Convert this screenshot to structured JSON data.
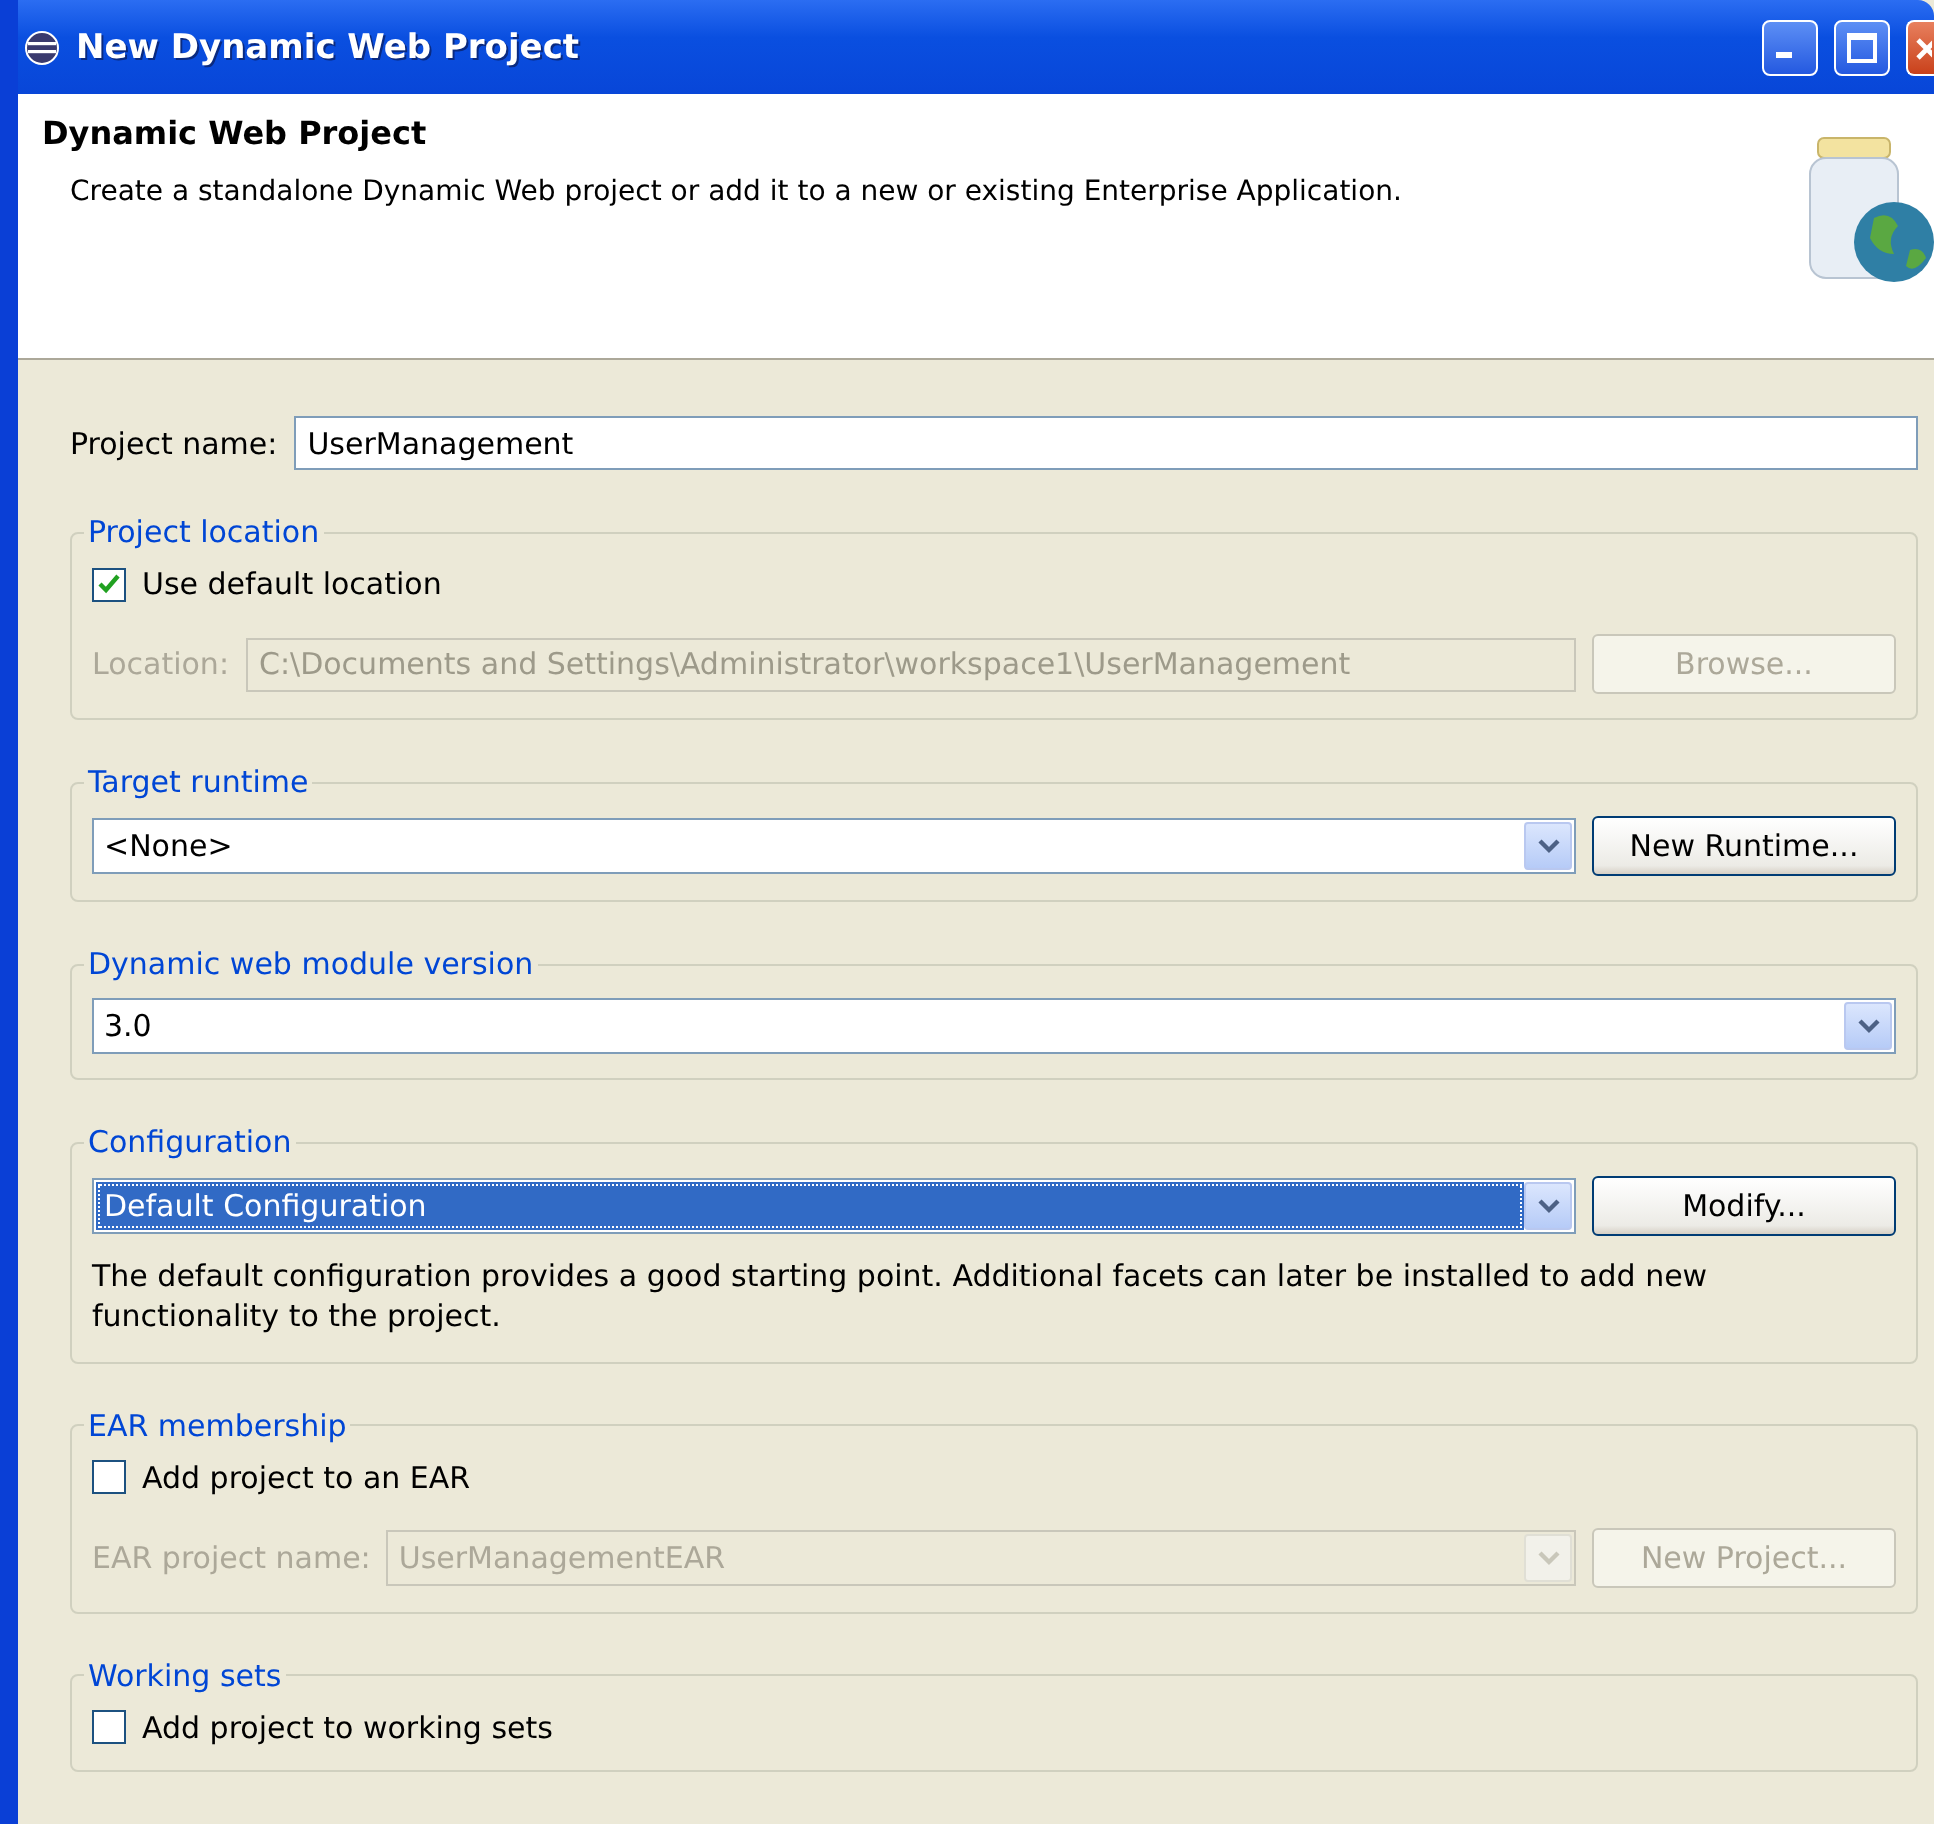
{
  "window": {
    "title": "New Dynamic Web Project"
  },
  "header": {
    "title": "Dynamic Web Project",
    "description": "Create a standalone Dynamic Web project or add it to a new or existing Enterprise Application."
  },
  "project_name": {
    "label": "Project name:",
    "value": "UserManagement"
  },
  "project_location": {
    "title": "Project location",
    "use_default": {
      "label": "Use default location",
      "checked": true
    },
    "location": {
      "label": "Location:",
      "value": "C:\\Documents and Settings\\Administrator\\workspace1\\UserManagement",
      "disabled": true
    },
    "button": {
      "label": "Browse...",
      "disabled": true
    }
  },
  "target_runtime": {
    "title": "Target runtime",
    "value": "<None>",
    "button": {
      "label": "New Runtime...",
      "disabled": false
    }
  },
  "module_version": {
    "title": "Dynamic web module version",
    "value": "3.0"
  },
  "configuration": {
    "title": "Configuration",
    "value": "Default Configuration",
    "selected": true,
    "button": {
      "label": "Modify...",
      "disabled": false
    },
    "description": "The default configuration provides a good starting point. Additional facets can later be installed to add new functionality to the project."
  },
  "ear_membership": {
    "title": "EAR membership",
    "add": {
      "label": "Add project to an EAR",
      "checked": false
    },
    "ear_name": {
      "label": "EAR project name:",
      "value": "UserManagementEAR",
      "disabled": true
    },
    "button": {
      "label": "New Project...",
      "disabled": true
    }
  },
  "working_sets": {
    "title": "Working sets",
    "add": {
      "label": "Add project to working sets",
      "checked": false
    }
  }
}
